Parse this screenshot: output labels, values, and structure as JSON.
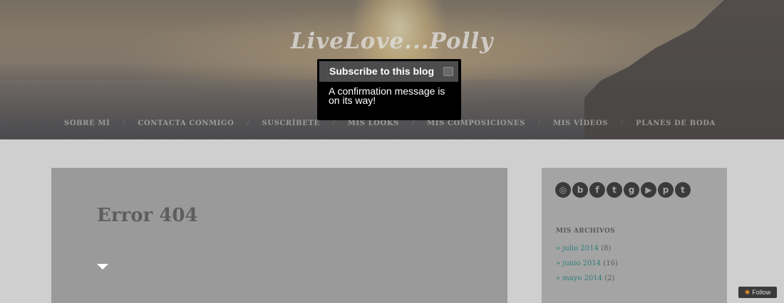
{
  "site": {
    "title": "LiveLove...Polly"
  },
  "nav": {
    "items": [
      "SOBRE MÍ",
      "CONTACTA CONMIGO",
      "SUSCRÍBETE",
      "MIS LOOKS",
      "MIS COMPOSICIONES",
      "MIS VÍDEOS",
      "PLANES DE BODA"
    ],
    "separator": "/"
  },
  "popup": {
    "title": "Subscribe to this blog",
    "message": "A confirmation message is on its way!"
  },
  "main": {
    "title": "Error 404"
  },
  "sidebar": {
    "social_icons": [
      "instagram-icon",
      "bloglovin-icon",
      "facebook-icon",
      "twitter-icon",
      "google-plus-icon",
      "youtube-icon",
      "pinterest-icon",
      "tumblr-icon"
    ],
    "social_glyphs": [
      "◎",
      "b",
      "f",
      "t",
      "g",
      "▶",
      "p",
      "t"
    ],
    "archive_heading": "MIS ARCHIVOS",
    "archives": [
      {
        "prefix": "» ",
        "label": "julio 2014",
        "count": "(8)"
      },
      {
        "prefix": "» ",
        "label": "junio 2014",
        "count": "(16)"
      },
      {
        "prefix": "» ",
        "label": "mayo 2014",
        "count": "(2)"
      }
    ]
  },
  "follow": {
    "label": "Follow",
    "icon": "✱"
  },
  "colors": {
    "accent_link": "#2f7f78",
    "popup_bg": "#000000",
    "follow_icon": "#e08a2a"
  }
}
